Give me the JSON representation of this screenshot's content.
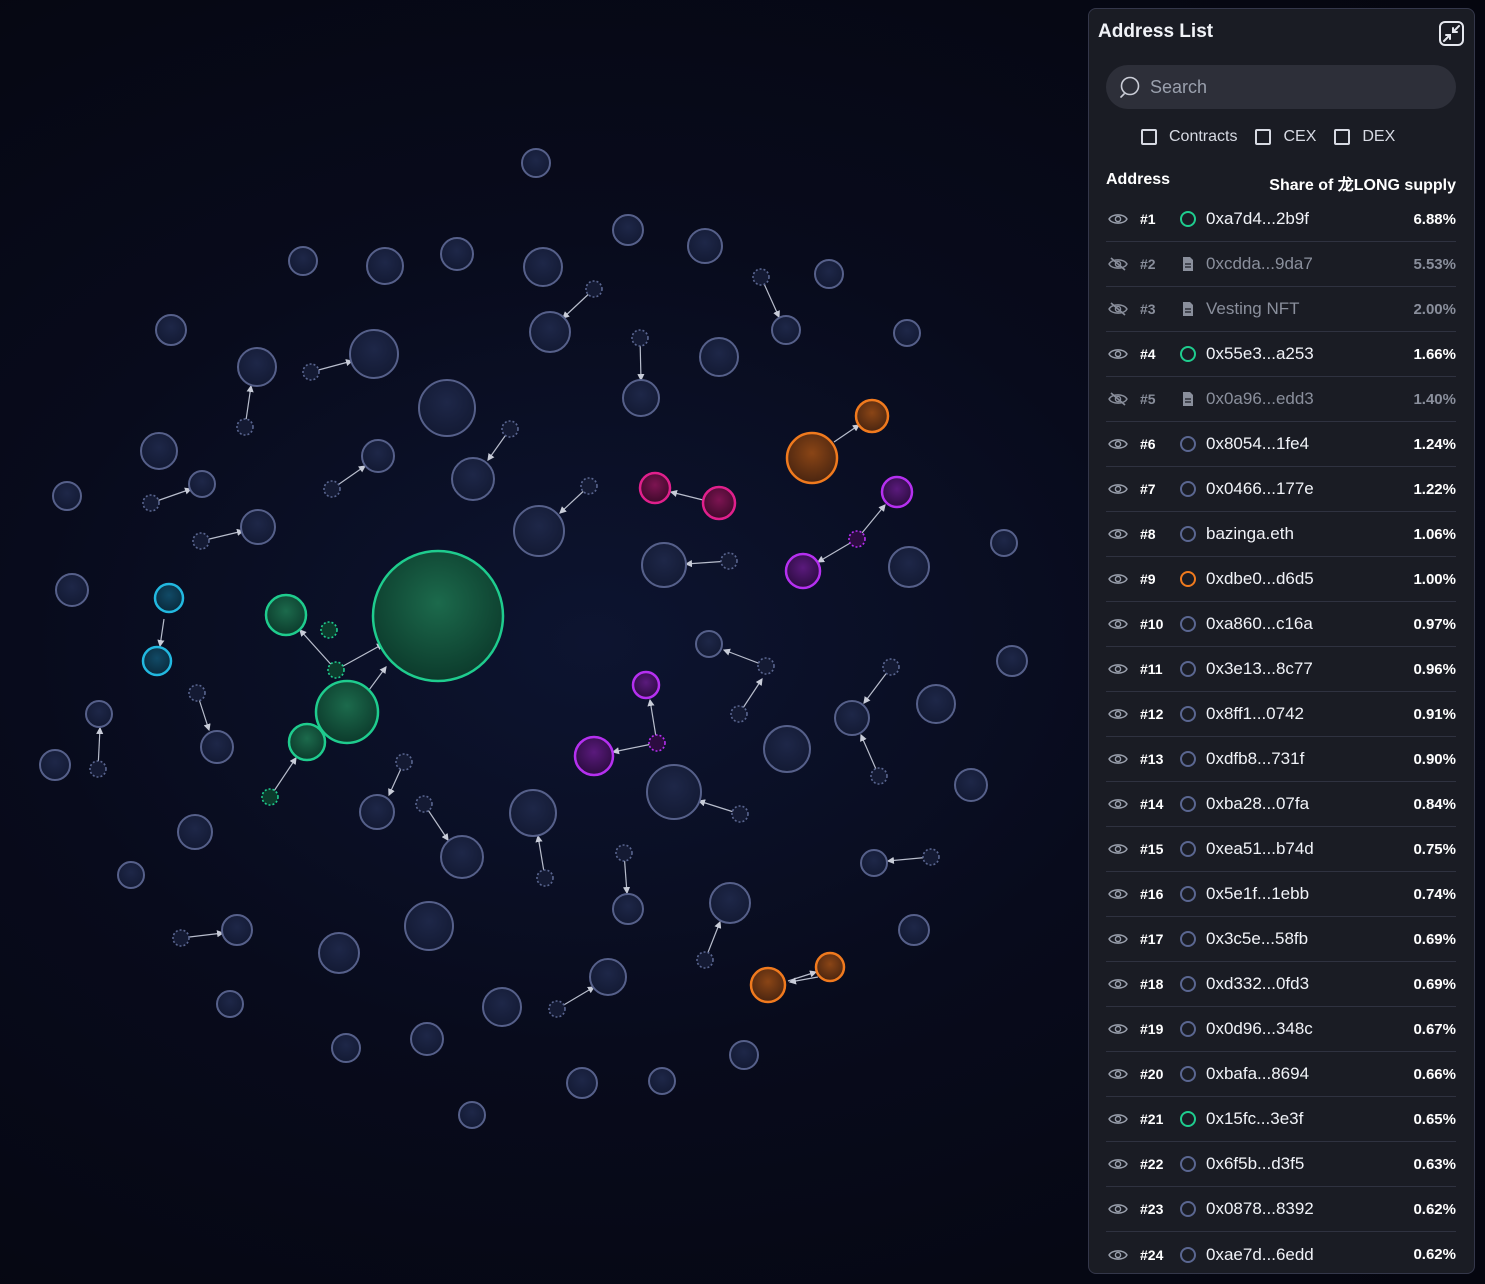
{
  "panel": {
    "title": "Address List",
    "search_placeholder": "Search",
    "filters": [
      "Contracts",
      "CEX",
      "DEX"
    ],
    "col_address": "Address",
    "col_share": "Share of 龙LONG supply"
  },
  "colors": {
    "default": "#5a6690",
    "green": "#1fcc8e",
    "orange": "#f07a1e",
    "magenta": "#e0208c",
    "purple": "#b530f0",
    "cyan": "#22b8e0"
  },
  "rows": [
    {
      "rank": "#1",
      "address": "0xa7d4...2b9f",
      "share": "6.88%",
      "kind": "green",
      "hidden": false
    },
    {
      "rank": "#2",
      "address": "0xcdda...9da7",
      "share": "5.53%",
      "kind": "contract",
      "hidden": true
    },
    {
      "rank": "#3",
      "address": "Vesting NFT",
      "share": "2.00%",
      "kind": "contract",
      "hidden": true
    },
    {
      "rank": "#4",
      "address": "0x55e3...a253",
      "share": "1.66%",
      "kind": "green",
      "hidden": false
    },
    {
      "rank": "#5",
      "address": "0x0a96...edd3",
      "share": "1.40%",
      "kind": "contract",
      "hidden": true
    },
    {
      "rank": "#6",
      "address": "0x8054...1fe4",
      "share": "1.24%",
      "kind": "default",
      "hidden": false
    },
    {
      "rank": "#7",
      "address": "0x0466...177e",
      "share": "1.22%",
      "kind": "default",
      "hidden": false
    },
    {
      "rank": "#8",
      "address": "bazinga.eth",
      "share": "1.06%",
      "kind": "default",
      "hidden": false
    },
    {
      "rank": "#9",
      "address": "0xdbe0...d6d5",
      "share": "1.00%",
      "kind": "orange",
      "hidden": false
    },
    {
      "rank": "#10",
      "address": "0xa860...c16a",
      "share": "0.97%",
      "kind": "default",
      "hidden": false
    },
    {
      "rank": "#11",
      "address": "0x3e13...8c77",
      "share": "0.96%",
      "kind": "default",
      "hidden": false
    },
    {
      "rank": "#12",
      "address": "0x8ff1...0742",
      "share": "0.91%",
      "kind": "default",
      "hidden": false
    },
    {
      "rank": "#13",
      "address": "0xdfb8...731f",
      "share": "0.90%",
      "kind": "default",
      "hidden": false
    },
    {
      "rank": "#14",
      "address": "0xba28...07fa",
      "share": "0.84%",
      "kind": "default",
      "hidden": false
    },
    {
      "rank": "#15",
      "address": "0xea51...b74d",
      "share": "0.75%",
      "kind": "default",
      "hidden": false
    },
    {
      "rank": "#16",
      "address": "0x5e1f...1ebb",
      "share": "0.74%",
      "kind": "default",
      "hidden": false
    },
    {
      "rank": "#17",
      "address": "0x3c5e...58fb",
      "share": "0.69%",
      "kind": "default",
      "hidden": false
    },
    {
      "rank": "#18",
      "address": "0xd332...0fd3",
      "share": "0.69%",
      "kind": "default",
      "hidden": false
    },
    {
      "rank": "#19",
      "address": "0x0d96...348c",
      "share": "0.67%",
      "kind": "default",
      "hidden": false
    },
    {
      "rank": "#20",
      "address": "0xbafa...8694",
      "share": "0.66%",
      "kind": "default",
      "hidden": false
    },
    {
      "rank": "#21",
      "address": "0x15fc...3e3f",
      "share": "0.65%",
      "kind": "green",
      "hidden": false
    },
    {
      "rank": "#22",
      "address": "0x6f5b...d3f5",
      "share": "0.63%",
      "kind": "default",
      "hidden": false
    },
    {
      "rank": "#23",
      "address": "0x0878...8392",
      "share": "0.62%",
      "kind": "default",
      "hidden": false
    },
    {
      "rank": "#24",
      "address": "0xae7d...6edd",
      "share": "0.62%",
      "kind": "default",
      "hidden": false
    }
  ]
}
